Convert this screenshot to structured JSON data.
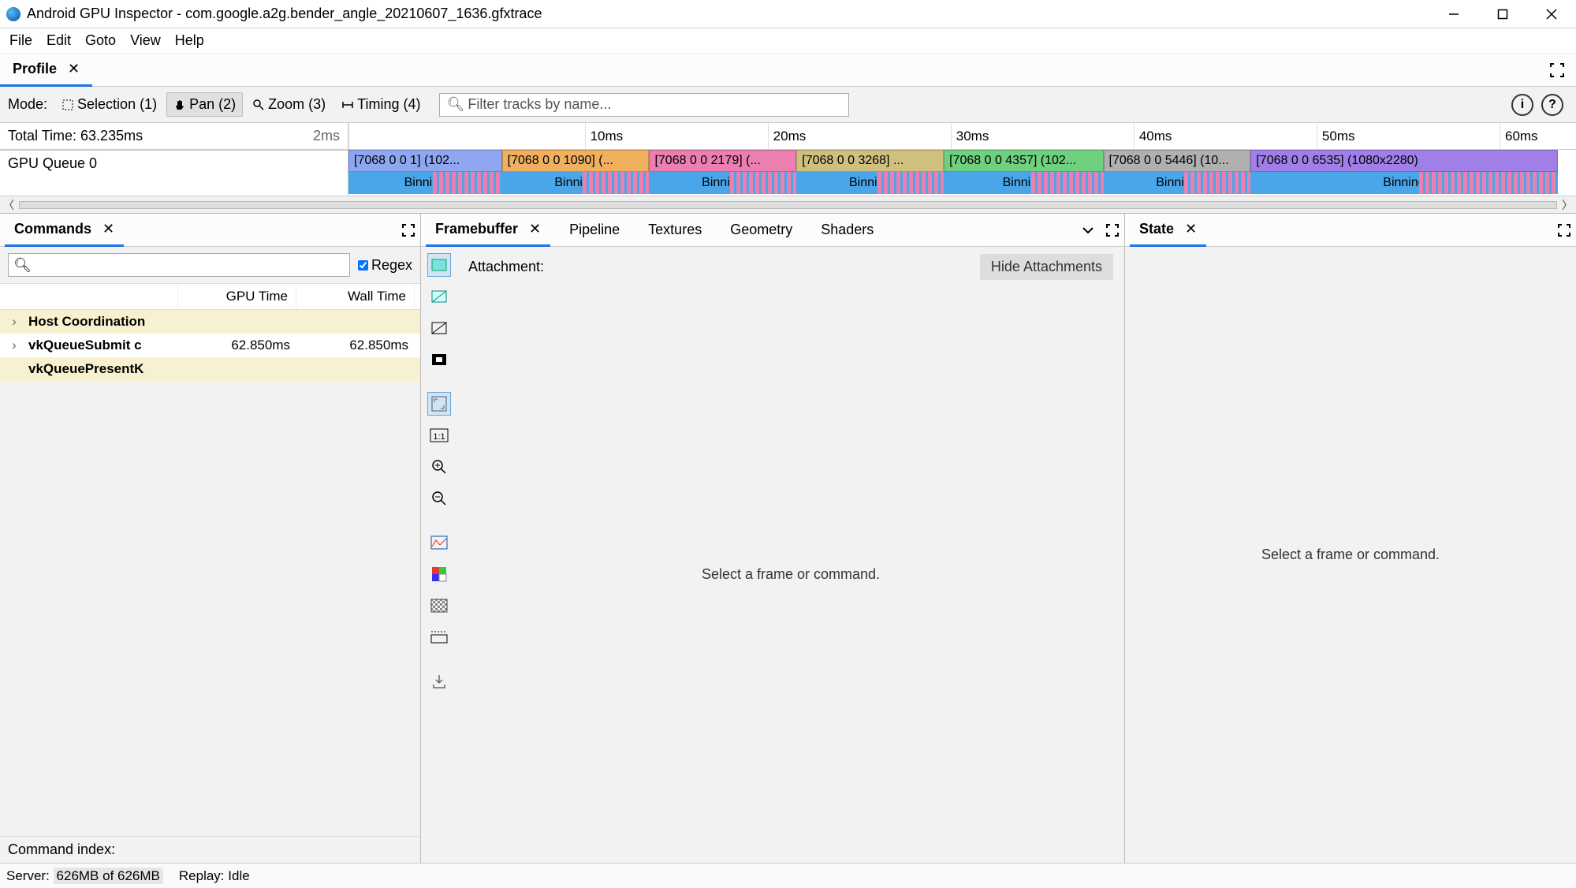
{
  "window": {
    "title": "Android GPU Inspector - com.google.a2g.bender_angle_20210607_1636.gfxtrace"
  },
  "menu": {
    "items": [
      "File",
      "Edit",
      "Goto",
      "View",
      "Help"
    ]
  },
  "profile_tab": {
    "label": "Profile"
  },
  "mode": {
    "label": "Mode:",
    "options": [
      {
        "label": "Selection (1)"
      },
      {
        "label": "Pan (2)"
      },
      {
        "label": "Zoom (3)"
      },
      {
        "label": "Timing (4)"
      }
    ],
    "active_index": 1,
    "filter_placeholder": "Filter tracks by name..."
  },
  "timeline": {
    "total_time_label": "Total Time: 63.235ms",
    "scale_label": "2ms",
    "ticks": [
      "10ms",
      "20ms",
      "30ms",
      "40ms",
      "50ms",
      "60ms"
    ],
    "gpu_queue_label": "GPU Queue 0",
    "blocks": [
      {
        "label": "[7068 0 0 1] (102...",
        "color": "#8fa6f0"
      },
      {
        "label": "[7068 0 0 1090] (...",
        "color": "#f0b060"
      },
      {
        "label": "[7068 0 0 2179] (...",
        "color": "#ea7fb0"
      },
      {
        "label": "[7068 0 0 3268] ...",
        "color": "#d0c080"
      },
      {
        "label": "[7068 0 0 4357] (102...",
        "color": "#6fd080"
      },
      {
        "label": "[7068 0 0 5446] (10...",
        "color": "#b0b0b0"
      },
      {
        "label": "[7068 0 0 6535] (1080x2280)",
        "color": "#a080e8"
      }
    ],
    "binning_label": "Binning",
    "binning_color": "#4aa6e8"
  },
  "commands": {
    "tab_label": "Commands",
    "regex_label": "Regex",
    "columns": {
      "name": "",
      "gpu": "GPU Time",
      "wall": "Wall Time"
    },
    "rows": [
      {
        "expandable": true,
        "hl": true,
        "name": "Host Coordination",
        "gpu": "",
        "wall": ""
      },
      {
        "expandable": true,
        "hl": false,
        "name": "vkQueueSubmit c",
        "gpu": "62.850ms",
        "wall": "62.850ms"
      },
      {
        "expandable": false,
        "hl": true,
        "name": "vkQueuePresentK",
        "gpu": "",
        "wall": ""
      }
    ],
    "footer_label": "Command index:"
  },
  "middle_tabs": {
    "tabs": [
      "Framebuffer",
      "Pipeline",
      "Textures",
      "Geometry",
      "Shaders"
    ],
    "active_index": 0
  },
  "framebuffer": {
    "attachment_label": "Attachment:",
    "hide_label": "Hide Attachments",
    "placeholder": "Select a frame or command."
  },
  "state": {
    "tab_label": "State",
    "placeholder": "Select a frame or command."
  },
  "statusbar": {
    "server_label": "Server:",
    "server_value": "626MB of 626MB",
    "replay_label": "Replay:",
    "replay_value": "Idle"
  }
}
